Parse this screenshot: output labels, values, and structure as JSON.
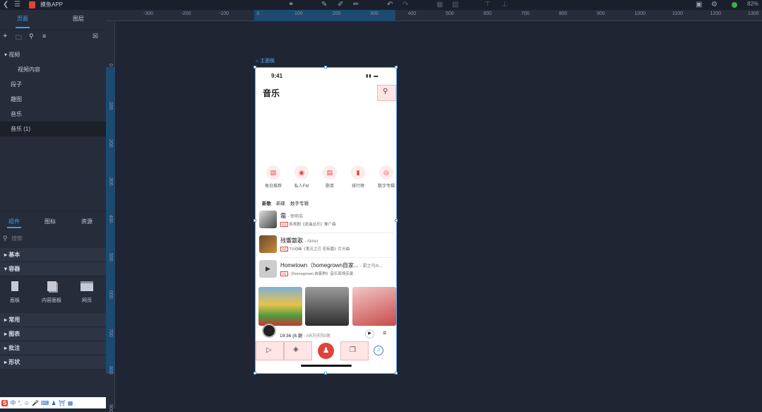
{
  "app": {
    "title": "摸鱼APP",
    "zoom": "82%"
  },
  "left_tabs": [
    "页面",
    "图层"
  ],
  "pages": [
    "视频",
    "视频内容",
    "段子",
    "趣图",
    "音乐",
    "音乐 (1)"
  ],
  "lower_tabs": [
    "组件",
    "图标",
    "资源"
  ],
  "search_placeholder": "搜索",
  "sections": [
    "基本",
    "容器",
    "常用",
    "图表",
    "批注",
    "形状"
  ],
  "components": [
    "面板",
    "内容面板",
    "网页"
  ],
  "ruler_top": [
    "-300",
    "-200",
    "-100",
    "0",
    "100",
    "200",
    "300",
    "400",
    "500",
    "600",
    "700",
    "800",
    "900",
    "1000",
    "1100",
    "1200",
    "1300"
  ],
  "ruler_left": [
    "0",
    "100",
    "200",
    "300",
    "400",
    "500",
    "600",
    "700",
    "800",
    "900"
  ],
  "artboard_label": "主面板",
  "phone": {
    "time": "9:41",
    "title": "音乐",
    "quick": [
      {
        "label": "每日推荐",
        "icon": "calendar-icon"
      },
      {
        "label": "私人FM",
        "icon": "radio-icon"
      },
      {
        "label": "歌单",
        "icon": "playlist-icon"
      },
      {
        "label": "排行榜",
        "icon": "chart-icon"
      },
      {
        "label": "数字专辑",
        "icon": "disc-icon"
      }
    ],
    "tabs": [
      "新歌",
      "新碟",
      "数字专辑"
    ],
    "songs": [
      {
        "title": "霜",
        "artist": "- 徐明浩",
        "tag": "SQ",
        "sub": "影视剧《逍遥丛乐》推广曲"
      },
      {
        "title": "残響散歌",
        "artist": "- Aimer",
        "tag": "SQ",
        "sub": "TV动画《鬼灭之刃 花街篇》片头曲"
      },
      {
        "title": "Hometown（homegrown自家...",
        "artist": "- 厨之鸟/h...",
        "tag": "SQ",
        "sub": "《homegrown 自家种》音乐现场实录"
      }
    ],
    "player": {
      "text": "19:36 (8.谢",
      "artist": "- AR刘夫阳/谢"
    }
  },
  "ime": [
    "中",
    "°,",
    "☺"
  ]
}
